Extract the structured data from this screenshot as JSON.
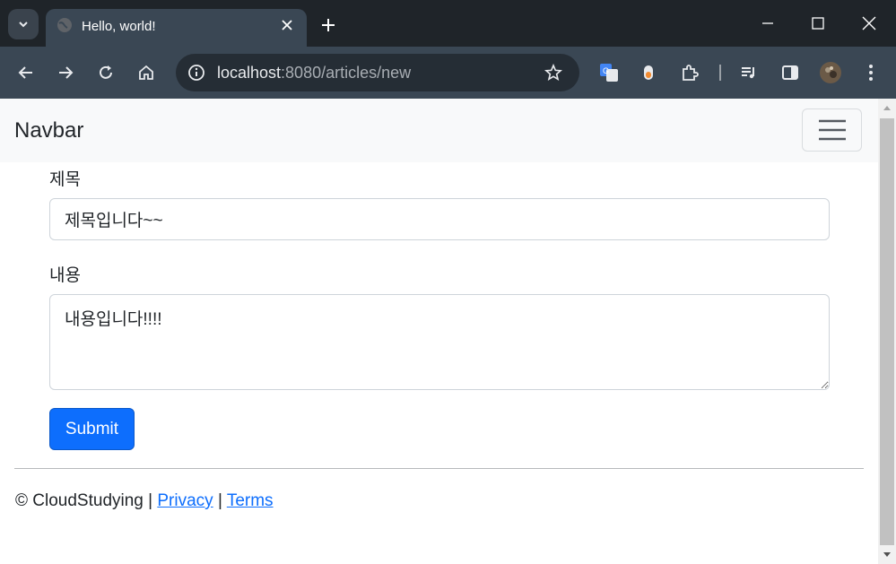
{
  "browser": {
    "tab_title": "Hello, world!",
    "url_host": "localhost",
    "url_path": ":8080/articles/new"
  },
  "navbar": {
    "brand": "Navbar"
  },
  "form": {
    "title_label": "제목",
    "title_value": "제목입니다~~",
    "content_label": "내용",
    "content_value": "내용입니다!!!!",
    "submit_label": "Submit"
  },
  "footer": {
    "copyright": "© CloudStudying |",
    "separator": "|",
    "privacy": "Privacy",
    "terms": "Terms"
  },
  "colors": {
    "primary": "#0d6efd",
    "navbar_bg": "#f8f9fa",
    "chrome_dark": "#1f2429",
    "chrome_toolbar": "#3a4754"
  }
}
